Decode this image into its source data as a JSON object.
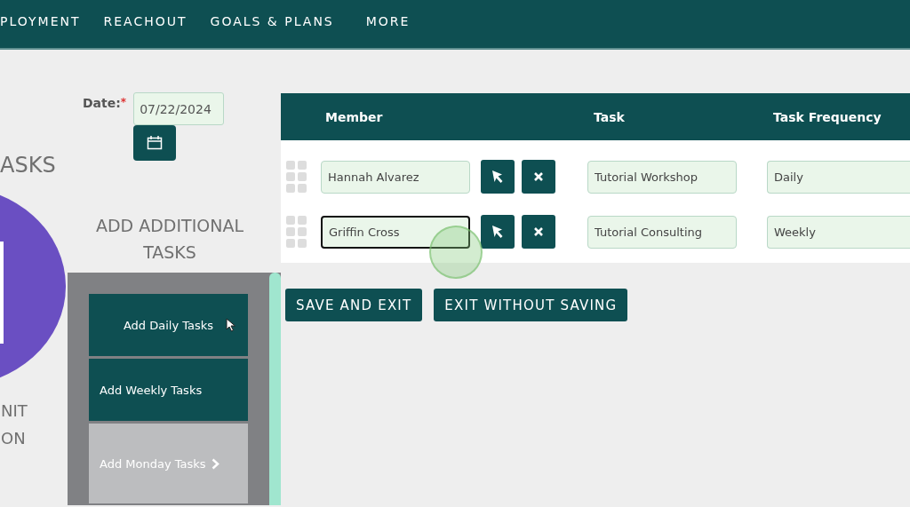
{
  "nav": {
    "items": [
      {
        "label": "PLOYMENT"
      },
      {
        "label": "REACHOUT"
      },
      {
        "label": "GOALS & PLANS"
      },
      {
        "label": "MORE"
      }
    ]
  },
  "left_panel": {
    "heading": "ASKS",
    "caption_lines": [
      "NIT",
      "ON"
    ]
  },
  "date": {
    "label": "Date:",
    "required_mark": "*",
    "value": "07/22/2024"
  },
  "additional_tasks": {
    "heading": "ADD ADDITIONAL TASKS",
    "items": [
      {
        "label": "Add Daily Tasks",
        "disabled": false,
        "chevron": false
      },
      {
        "label": "Add Weekly Tasks",
        "disabled": false,
        "chevron": false
      },
      {
        "label": "Add Monday Tasks",
        "disabled": true,
        "chevron": true
      }
    ]
  },
  "table": {
    "columns": [
      "Member",
      "Task",
      "Task Frequency"
    ],
    "rows": [
      {
        "member": "Hannah Alvarez",
        "task": "Tutorial Workshop",
        "frequency": "Daily",
        "focused": false
      },
      {
        "member": "Griffin Cross",
        "task": "Tutorial Consulting",
        "frequency": "Weekly",
        "focused": true
      }
    ]
  },
  "buttons": [
    "SAVE AND EXIT",
    "EXIT WITHOUT SAVING"
  ]
}
